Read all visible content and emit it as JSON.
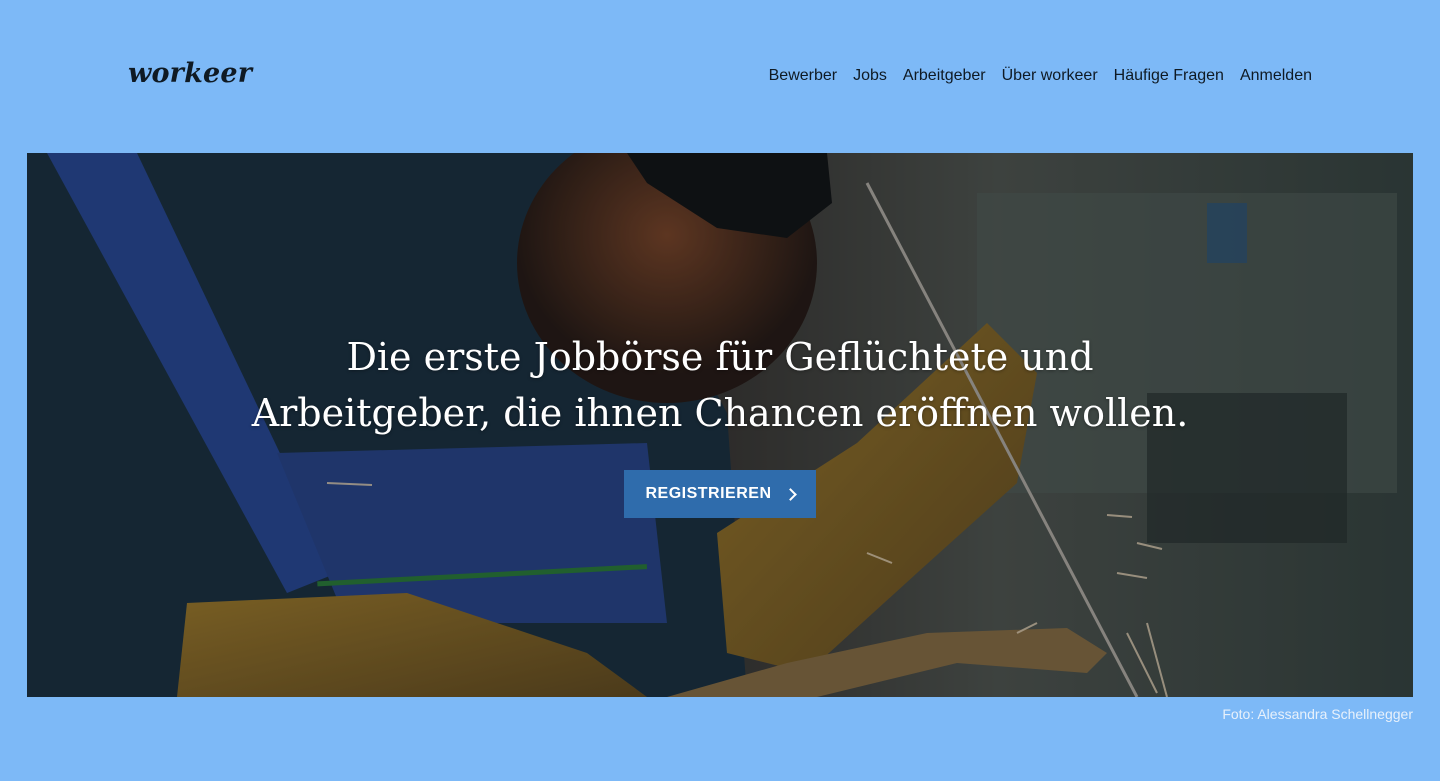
{
  "header": {
    "logo": "workeer",
    "nav": [
      {
        "label": "Bewerber"
      },
      {
        "label": "Jobs"
      },
      {
        "label": "Arbeitgeber"
      },
      {
        "label": "Über workeer"
      },
      {
        "label": "Häufige Fragen"
      },
      {
        "label": "Anmelden"
      }
    ]
  },
  "hero": {
    "title_line1": "Die erste Jobbörse für Geflüchtete und",
    "title_line2": "Arbeitgeber, die ihnen Chancen eröffnen wollen.",
    "cta_label": "REGISTRIEREN",
    "cta_icon": "chevron-right-icon"
  },
  "photo_credit": "Foto: Alessandra Schellnegger",
  "colors": {
    "page_background": "#7db9f7",
    "cta_background": "#2f6cac",
    "text_dark": "#0f1a24"
  }
}
